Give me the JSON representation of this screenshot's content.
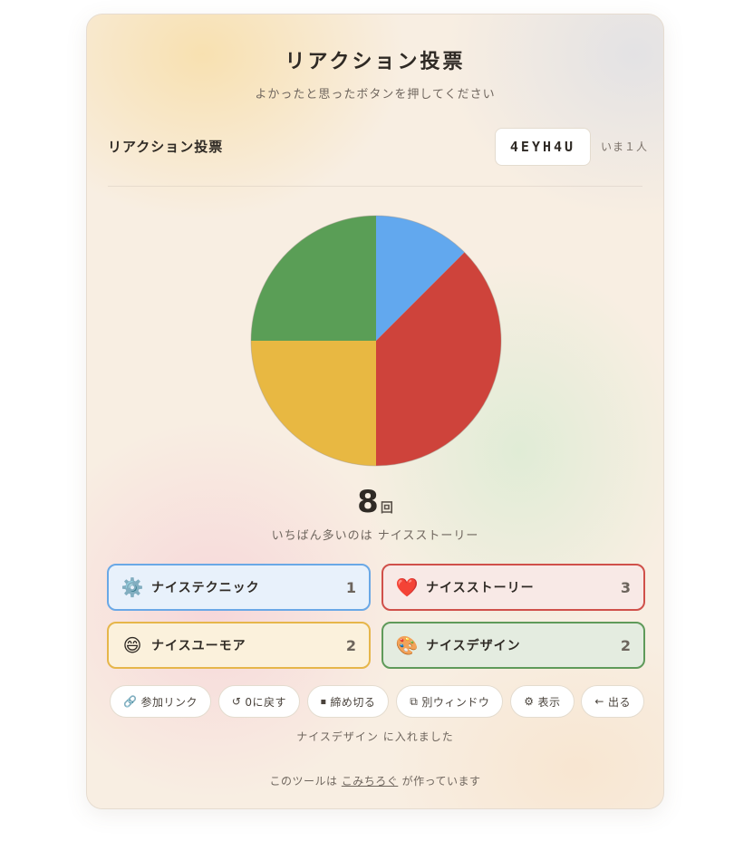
{
  "header": {
    "title": "リアクション投票",
    "subtitle": "よかったと思ったボタンを押してください"
  },
  "room": {
    "label": "リアクション投票",
    "code": "4EYH4U",
    "online": "いま１人"
  },
  "chart_data": {
    "type": "pie",
    "slices": [
      {
        "label": "ナイステクニック",
        "value": 1,
        "color": "#62a8ee"
      },
      {
        "label": "ナイスストーリー",
        "value": 3,
        "color": "#ce433b"
      },
      {
        "label": "ナイスユーモア",
        "value": 2,
        "color": "#e8b842"
      },
      {
        "label": "ナイスデザイン",
        "value": 2,
        "color": "#5a9e56"
      }
    ]
  },
  "summary": {
    "total": "8",
    "unit": "回",
    "leader": "いちばん多いのは ナイスストーリー"
  },
  "buttons": [
    {
      "icon": "⚙️",
      "icon_name": "gear-icon",
      "label": "ナイステクニック",
      "count": "1",
      "border": "#6aa8e6",
      "bg": "#e8f1fb"
    },
    {
      "icon": "❤️",
      "icon_name": "heart-icon",
      "label": "ナイスストーリー",
      "count": "3",
      "border": "#d0504a",
      "bg": "#f8e9e6"
    },
    {
      "icon": "😄",
      "icon_name": "smile-icon",
      "label": "ナイスユーモア",
      "count": "2",
      "border": "#e6b64a",
      "bg": "#fbf1dc"
    },
    {
      "icon": "🎨",
      "icon_name": "palette-icon",
      "label": "ナイスデザイン",
      "count": "2",
      "border": "#5f9a5a",
      "bg": "#e4ece0"
    }
  ],
  "actions": [
    {
      "icon": "🔗",
      "label": "参加リンク",
      "name": "join-link-button",
      "icon_name": "link-icon"
    },
    {
      "icon": "↺",
      "label": "0に戻す",
      "name": "reset-button",
      "icon_name": "reset-icon"
    },
    {
      "icon": "⏹",
      "label": "締め切る",
      "name": "close-voting-button",
      "icon_name": "stop-icon"
    },
    {
      "icon": "⧉",
      "label": "別ウィンドウ",
      "name": "new-window-button",
      "icon_name": "window-icon"
    },
    {
      "icon": "⚙",
      "label": "表示",
      "name": "display-settings-button",
      "icon_name": "gear-icon"
    },
    {
      "icon": "←",
      "label": "出る",
      "name": "leave-button",
      "icon_name": "arrow-left-icon"
    }
  ],
  "status": "ナイスデザイン に入れました",
  "footer": {
    "prefix": "このツールは",
    "link": "こみちろぐ",
    "suffix": "が作っています"
  }
}
